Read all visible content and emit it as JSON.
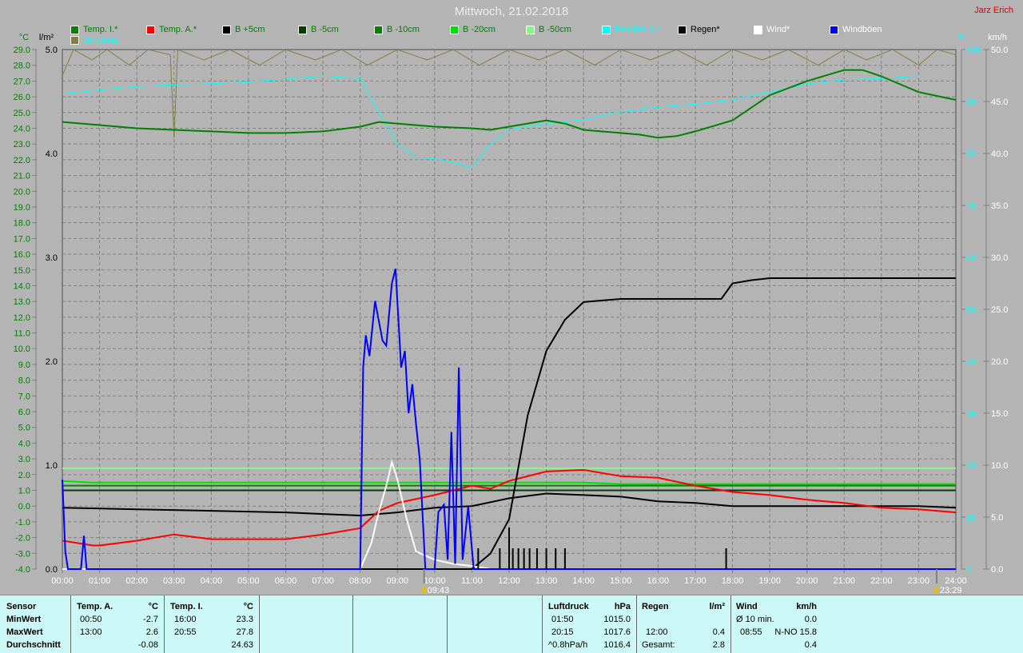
{
  "header": {
    "title": "Mittwoch, 21.02.2018",
    "author": "Jarz Erich"
  },
  "legend": [
    {
      "label": "Temp. I.*",
      "color": "#008000",
      "text_color": "#008000"
    },
    {
      "label": "Temp. A.*",
      "color": "#ff0000",
      "text_color": "#008000"
    },
    {
      "label": "B +5cm",
      "color": "#000000",
      "text_color": "#008000"
    },
    {
      "label": "B -5cm",
      "color": "#003c00",
      "text_color": "#008000"
    },
    {
      "label": "B -10cm",
      "color": "#008000",
      "text_color": "#008000"
    },
    {
      "label": "B -20cm",
      "color": "#00e000",
      "text_color": "#008000"
    },
    {
      "label": "B -50cm",
      "color": "#80ff80",
      "text_color": "#008000"
    },
    {
      "label": "Feuchte A.*",
      "color": "#00ffff",
      "text_color": "#00ffff"
    },
    {
      "label": "Regen*",
      "color": "#000000",
      "text_color": "#000000"
    },
    {
      "label": "Wind*",
      "color": "#ffffff",
      "text_color": "#ffffff"
    },
    {
      "label": "Windböen",
      "color": "#0000ff",
      "text_color": "#ffffff"
    },
    {
      "label": "Empfang",
      "color": "#808040",
      "text_color": "#00ffff"
    }
  ],
  "chart_data": {
    "type": "line",
    "title": "Mittwoch, 21.02.2018",
    "x_axis": {
      "unit": "hours",
      "range": [
        0,
        24
      ],
      "tick_labels": [
        "00:00",
        "01:00",
        "02:00",
        "03:00",
        "04:00",
        "05:00",
        "06:00",
        "07:00",
        "08:00",
        "09:00",
        "10:00",
        "11:00",
        "12:00",
        "13:00",
        "14:00",
        "15:00",
        "16:00",
        "17:00",
        "18:00",
        "19:00",
        "20:00",
        "21:00",
        "22:00",
        "23:00",
        "24:00"
      ]
    },
    "axes": {
      "temp": {
        "label": "°C",
        "range": [
          -4,
          29
        ],
        "color": "#008000"
      },
      "rain": {
        "label": "l/m²",
        "range": [
          0,
          5
        ],
        "color": "#000000"
      },
      "humidity": {
        "label": "%",
        "range": [
          0,
          100
        ],
        "color": "#00ffff"
      },
      "wind": {
        "label": "km/h",
        "range": [
          0,
          50
        ],
        "color": "#ffffff"
      }
    },
    "grid": true,
    "markers": [
      {
        "time": 9.717,
        "label": "09:43",
        "icon": "sun-icon"
      },
      {
        "time": 23.483,
        "label": "23:29",
        "icon": "arrow-icon"
      }
    ],
    "series": [
      {
        "name": "Empfang",
        "axis": "humidity",
        "color": "#808040",
        "points": [
          [
            0,
            95
          ],
          [
            0.3,
            100
          ],
          [
            0.8,
            98
          ],
          [
            1.2,
            100
          ],
          [
            1.8,
            97
          ],
          [
            2.3,
            100
          ],
          [
            2.9,
            99
          ],
          [
            3.0,
            83
          ],
          [
            3.1,
            100
          ],
          [
            3.8,
            98
          ],
          [
            4.5,
            100
          ],
          [
            5.3,
            97
          ],
          [
            6.0,
            100
          ],
          [
            6.8,
            98
          ],
          [
            7.5,
            100
          ],
          [
            8.2,
            97
          ],
          [
            9.0,
            100
          ],
          [
            9.8,
            98
          ],
          [
            10.5,
            100
          ],
          [
            11.2,
            97
          ],
          [
            12.0,
            100
          ],
          [
            12.8,
            98
          ],
          [
            13.5,
            100
          ],
          [
            14.3,
            97
          ],
          [
            15.0,
            100
          ],
          [
            15.8,
            98
          ],
          [
            16.5,
            100
          ],
          [
            17.3,
            97
          ],
          [
            18.0,
            100
          ],
          [
            18.8,
            98
          ],
          [
            19.5,
            100
          ],
          [
            20.3,
            97
          ],
          [
            21.0,
            100
          ],
          [
            21.6,
            98
          ],
          [
            22.3,
            100
          ],
          [
            23.0,
            97
          ],
          [
            23.5,
            100
          ],
          [
            24,
            99
          ]
        ]
      },
      {
        "name": "Feuchte A.*",
        "axis": "humidity",
        "color": "#00ffff",
        "points": [
          [
            0,
            91.4
          ],
          [
            1,
            92.2
          ],
          [
            2,
            92.9
          ],
          [
            3,
            93.2
          ],
          [
            4,
            93.4
          ],
          [
            5,
            93.8
          ],
          [
            6,
            94.3
          ],
          [
            7,
            94.9
          ],
          [
            8,
            94.4
          ],
          [
            8.5,
            88
          ],
          [
            9,
            81.8
          ],
          [
            9.5,
            79.2
          ],
          [
            10,
            79
          ],
          [
            10.5,
            78.3
          ],
          [
            11,
            77.2
          ],
          [
            11.5,
            81.8
          ],
          [
            12,
            84.6
          ],
          [
            13,
            85.7
          ],
          [
            14,
            86.5
          ],
          [
            15,
            88
          ],
          [
            16,
            88.9
          ],
          [
            17,
            89.5
          ],
          [
            18,
            90.3
          ],
          [
            19,
            91.8
          ],
          [
            20,
            93.4
          ],
          [
            21,
            94.2
          ],
          [
            22,
            94.4
          ],
          [
            23,
            94.9
          ]
        ]
      },
      {
        "name": "Temp. I.*",
        "axis": "temp",
        "color": "#008000",
        "points": [
          [
            0,
            24.4
          ],
          [
            1,
            24.2
          ],
          [
            2,
            24
          ],
          [
            3,
            23.9
          ],
          [
            4,
            23.8
          ],
          [
            5,
            23.7
          ],
          [
            6,
            23.7
          ],
          [
            7,
            23.8
          ],
          [
            8,
            24.1
          ],
          [
            8.5,
            24.4
          ],
          [
            9,
            24.3
          ],
          [
            10,
            24.1
          ],
          [
            11,
            24
          ],
          [
            11.5,
            23.9
          ],
          [
            12,
            24.1
          ],
          [
            13,
            24.5
          ],
          [
            13.5,
            24.3
          ],
          [
            14,
            23.9
          ],
          [
            15,
            23.7
          ],
          [
            15.5,
            23.6
          ],
          [
            16,
            23.4
          ],
          [
            16.5,
            23.5
          ],
          [
            17,
            23.8
          ],
          [
            18,
            24.5
          ],
          [
            19,
            26.1
          ],
          [
            20,
            27
          ],
          [
            21,
            27.7
          ],
          [
            21.5,
            27.7
          ],
          [
            22,
            27.3
          ],
          [
            23,
            26.3
          ],
          [
            24,
            25.8
          ]
        ]
      },
      {
        "name": "B -50cm",
        "axis": "temp",
        "color": "#80ff80",
        "points": [
          [
            0,
            2.4
          ],
          [
            24,
            2.4
          ]
        ]
      },
      {
        "name": "B -20cm",
        "axis": "temp",
        "color": "#00e000",
        "points": [
          [
            0,
            1.6
          ],
          [
            0.8,
            1.5
          ],
          [
            6,
            1.5
          ],
          [
            14,
            1.5
          ],
          [
            15,
            1.4
          ],
          [
            24,
            1.4
          ]
        ]
      },
      {
        "name": "B -10cm",
        "axis": "temp",
        "color": "#008000",
        "points": [
          [
            0,
            1.3
          ],
          [
            24,
            1.3
          ]
        ]
      },
      {
        "name": "B -5cm",
        "axis": "temp",
        "color": "#003c00",
        "points": [
          [
            0,
            1.0
          ],
          [
            24,
            1.0
          ]
        ]
      },
      {
        "name": "B +5cm",
        "axis": "temp",
        "color": "#000000",
        "points": [
          [
            0,
            -0.1
          ],
          [
            2,
            -0.2
          ],
          [
            4,
            -0.3
          ],
          [
            6,
            -0.4
          ],
          [
            7,
            -0.5
          ],
          [
            8,
            -0.6
          ],
          [
            9,
            -0.4
          ],
          [
            10,
            -0.1
          ],
          [
            11,
            0
          ],
          [
            12,
            0.5
          ],
          [
            13,
            0.8
          ],
          [
            14,
            0.7
          ],
          [
            15,
            0.6
          ],
          [
            16,
            0.3
          ],
          [
            17,
            0.2
          ],
          [
            18,
            0
          ],
          [
            21,
            0
          ],
          [
            23,
            0
          ],
          [
            24,
            -0.1
          ]
        ]
      },
      {
        "name": "Temp. A.*",
        "axis": "temp",
        "color": "#ff0000",
        "points": [
          [
            0,
            -2.2
          ],
          [
            0.83,
            -2.5
          ],
          [
            1,
            -2.5
          ],
          [
            2,
            -2.2
          ],
          [
            3,
            -1.8
          ],
          [
            4,
            -2.1
          ],
          [
            5,
            -2.1
          ],
          [
            6,
            -2.1
          ],
          [
            7,
            -1.8
          ],
          [
            8,
            -1.4
          ],
          [
            8.5,
            -0.3
          ],
          [
            9,
            0.2
          ],
          [
            10,
            0.7
          ],
          [
            11,
            1.3
          ],
          [
            11.5,
            1.1
          ],
          [
            12,
            1.6
          ],
          [
            13,
            2.2
          ],
          [
            14,
            2.3
          ],
          [
            15,
            1.9
          ],
          [
            16,
            1.8
          ],
          [
            17,
            1.3
          ],
          [
            18,
            0.9
          ],
          [
            19,
            0.7
          ],
          [
            20,
            0.4
          ],
          [
            21,
            0.2
          ],
          [
            22,
            -0.1
          ],
          [
            23,
            -0.2
          ],
          [
            24,
            -0.4
          ]
        ]
      },
      {
        "name": "Regen*",
        "axis": "rain",
        "color": "#000000",
        "points": [
          [
            0,
            0
          ],
          [
            11,
            0
          ],
          [
            11.5,
            0.15
          ],
          [
            12,
            0.48
          ],
          [
            12.5,
            1.48
          ],
          [
            13,
            2.1
          ],
          [
            13.5,
            2.4
          ],
          [
            14,
            2.57
          ],
          [
            15,
            2.6
          ],
          [
            17.7,
            2.6
          ],
          [
            18,
            2.75
          ],
          [
            18.5,
            2.78
          ],
          [
            19,
            2.8
          ],
          [
            24,
            2.8
          ]
        ]
      },
      {
        "name": "Wind*",
        "axis": "wind",
        "color": "#ffffff",
        "points": [
          [
            0,
            0
          ],
          [
            8,
            0
          ],
          [
            8.3,
            2.5
          ],
          [
            8.5,
            5.5
          ],
          [
            8.7,
            8
          ],
          [
            8.85,
            10.3
          ],
          [
            9,
            8.6
          ],
          [
            9.25,
            4.8
          ],
          [
            9.5,
            1.7
          ],
          [
            10,
            0.9
          ],
          [
            10.5,
            0.5
          ],
          [
            11,
            0.3
          ],
          [
            11.5,
            0
          ],
          [
            24,
            0
          ]
        ]
      },
      {
        "name": "Windböen",
        "axis": "wind",
        "color": "#0000ff",
        "points": [
          [
            0,
            8.6
          ],
          [
            0.08,
            1.7
          ],
          [
            0.15,
            0
          ],
          [
            0.5,
            0
          ],
          [
            0.58,
            3.2
          ],
          [
            0.65,
            0
          ],
          [
            8,
            0
          ],
          [
            8.08,
            19.4
          ],
          [
            8.15,
            22.5
          ],
          [
            8.25,
            20.5
          ],
          [
            8.4,
            25.8
          ],
          [
            8.6,
            22
          ],
          [
            8.7,
            21.5
          ],
          [
            8.85,
            27.5
          ],
          [
            8.95,
            28.9
          ],
          [
            9.1,
            19.4
          ],
          [
            9.2,
            21
          ],
          [
            9.3,
            15
          ],
          [
            9.4,
            17.8
          ],
          [
            9.5,
            14
          ],
          [
            9.6,
            10.6
          ],
          [
            9.75,
            0
          ],
          [
            10.0,
            0
          ],
          [
            10.1,
            5.5
          ],
          [
            10.25,
            6.2
          ],
          [
            10.35,
            0.9
          ],
          [
            10.45,
            13.2
          ],
          [
            10.55,
            0.5
          ],
          [
            10.65,
            19.4
          ],
          [
            10.75,
            0.9
          ],
          [
            10.9,
            6
          ],
          [
            11.05,
            0
          ],
          [
            24,
            0
          ]
        ]
      }
    ],
    "rain_bars": {
      "axis": "rain",
      "color": "#000000",
      "points": [
        [
          11.17,
          0.2
        ],
        [
          11.75,
          0.2
        ],
        [
          12.0,
          0.4
        ],
        [
          12.1,
          0.2
        ],
        [
          12.25,
          0.2
        ],
        [
          12.4,
          0.2
        ],
        [
          12.55,
          0.2
        ],
        [
          12.75,
          0.2
        ],
        [
          13.0,
          0.2
        ],
        [
          13.25,
          0.2
        ],
        [
          13.5,
          0.2
        ],
        [
          17.83,
          0.2
        ]
      ]
    }
  },
  "footer": {
    "sensor": {
      "header": "Sensor",
      "rows": [
        "MinWert",
        "MaxWert",
        "Durchschnitt"
      ]
    },
    "temp_a": {
      "header": "Temp. A.",
      "unit": "°C",
      "min_time": "00:50",
      "min": "-2.7",
      "max_time": "13:00",
      "max": "2.6",
      "avg": "-0.08"
    },
    "temp_i": {
      "header": "Temp. I.",
      "unit": "°C",
      "min_time": "16:00",
      "min": "23.3",
      "max_time": "20:55",
      "max": "27.8",
      "avg": "24.63"
    },
    "pressure": {
      "header": "Luftdruck",
      "unit": "hPa",
      "min_time": "01:50",
      "min": "1015.0",
      "max_time": "20:15",
      "max": "1017.6",
      "trend": "^0.8hPa/h",
      "current": "1016.4"
    },
    "rain": {
      "header": "Regen",
      "unit": "l/m²",
      "max_time": "12:00",
      "max": "0.4",
      "total_label": "Gesamt:",
      "total": "2.8"
    },
    "wind": {
      "header": "Wind",
      "unit": "km/h",
      "avg_label": "Ø 10 min.",
      "avg": "0.0",
      "max_time": "08:55",
      "max_dir": "N-NO 15.8",
      "last": "0.4"
    }
  }
}
